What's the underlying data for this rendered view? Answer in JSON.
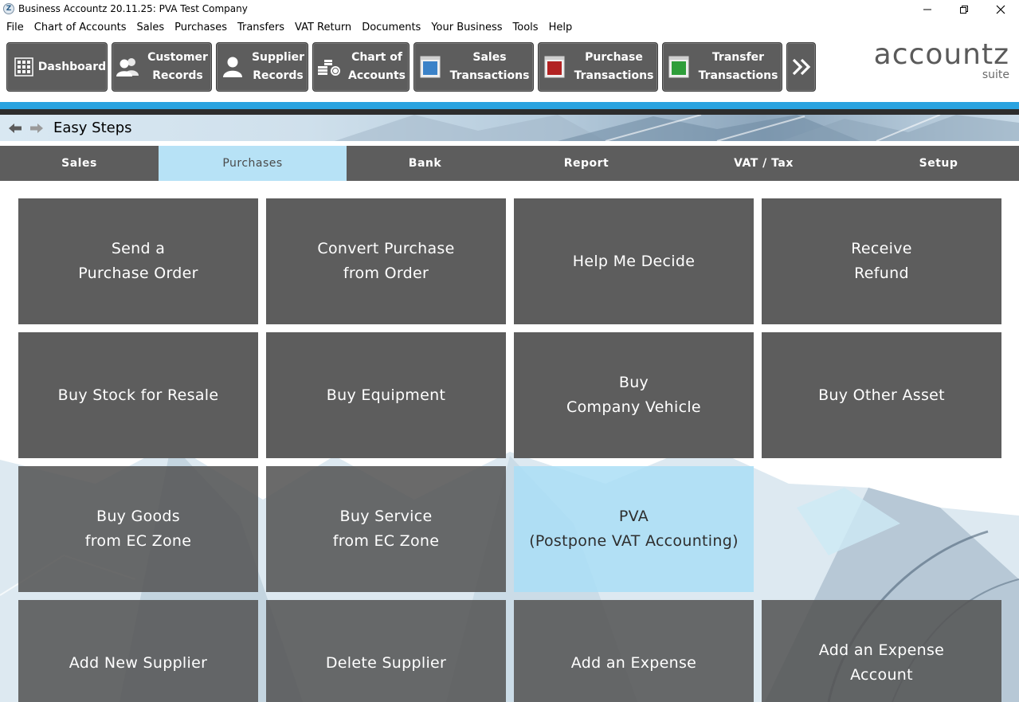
{
  "window": {
    "title": "Business Accountz 20.11.25: PVA Test Company",
    "app_icon": "Z"
  },
  "menu": [
    "File",
    "Chart of Accounts",
    "Sales",
    "Purchases",
    "Transfers",
    "VAT Return",
    "Documents",
    "Your Business",
    "Tools",
    "Help"
  ],
  "toolbar": {
    "buttons": [
      {
        "label": "Dashboard",
        "icon": "grid-icon"
      },
      {
        "label": "Customer\nRecords",
        "icon": "customers-icon"
      },
      {
        "label": "Supplier\nRecords",
        "icon": "supplier-icon"
      },
      {
        "label": "Chart of\nAccounts",
        "icon": "coins-icon"
      },
      {
        "label": "Sales\nTransactions",
        "icon": "blue-book-icon",
        "color": "#3b82c8"
      },
      {
        "label": "Purchase\nTransactions",
        "icon": "red-book-icon",
        "color": "#b22222"
      },
      {
        "label": "Transfer\nTransactions",
        "icon": "green-book-icon",
        "color": "#2e9e3a"
      },
      {
        "label": "",
        "icon": "double-chevron-right-icon"
      }
    ]
  },
  "logo": {
    "main": "accountz",
    "sub": "suite"
  },
  "banner": {
    "title": "Easy Steps"
  },
  "tabs": [
    {
      "label": "Sales",
      "active": false
    },
    {
      "label": "Purchases",
      "active": true
    },
    {
      "label": "Bank",
      "active": false
    },
    {
      "label": "Report",
      "active": false
    },
    {
      "label": "VAT / Tax",
      "active": false
    },
    {
      "label": "Setup",
      "active": false
    }
  ],
  "tiles": [
    {
      "label": "Send a\nPurchase Order"
    },
    {
      "label": "Convert Purchase\nfrom Order"
    },
    {
      "label": "Help Me Decide"
    },
    {
      "label": "Receive\nRefund"
    },
    {
      "label": "Buy Stock for Resale"
    },
    {
      "label": "Buy Equipment"
    },
    {
      "label": "Buy\nCompany Vehicle"
    },
    {
      "label": "Buy Other Asset"
    },
    {
      "label": "Buy Goods\nfrom EC Zone"
    },
    {
      "label": "Buy Service\nfrom EC Zone"
    },
    {
      "label": "PVA\n(Postpone VAT Accounting)",
      "highlighted": true
    },
    {
      "label": "Add New Supplier"
    },
    {
      "label": "Delete Supplier"
    },
    {
      "label": "Add an Expense"
    },
    {
      "label": "Add an Expense\nAccount"
    }
  ],
  "colors": {
    "button_gray": "#5d5d5d",
    "accent_blue": "#2aa3e0",
    "active_tab": "#b7e2f6"
  }
}
